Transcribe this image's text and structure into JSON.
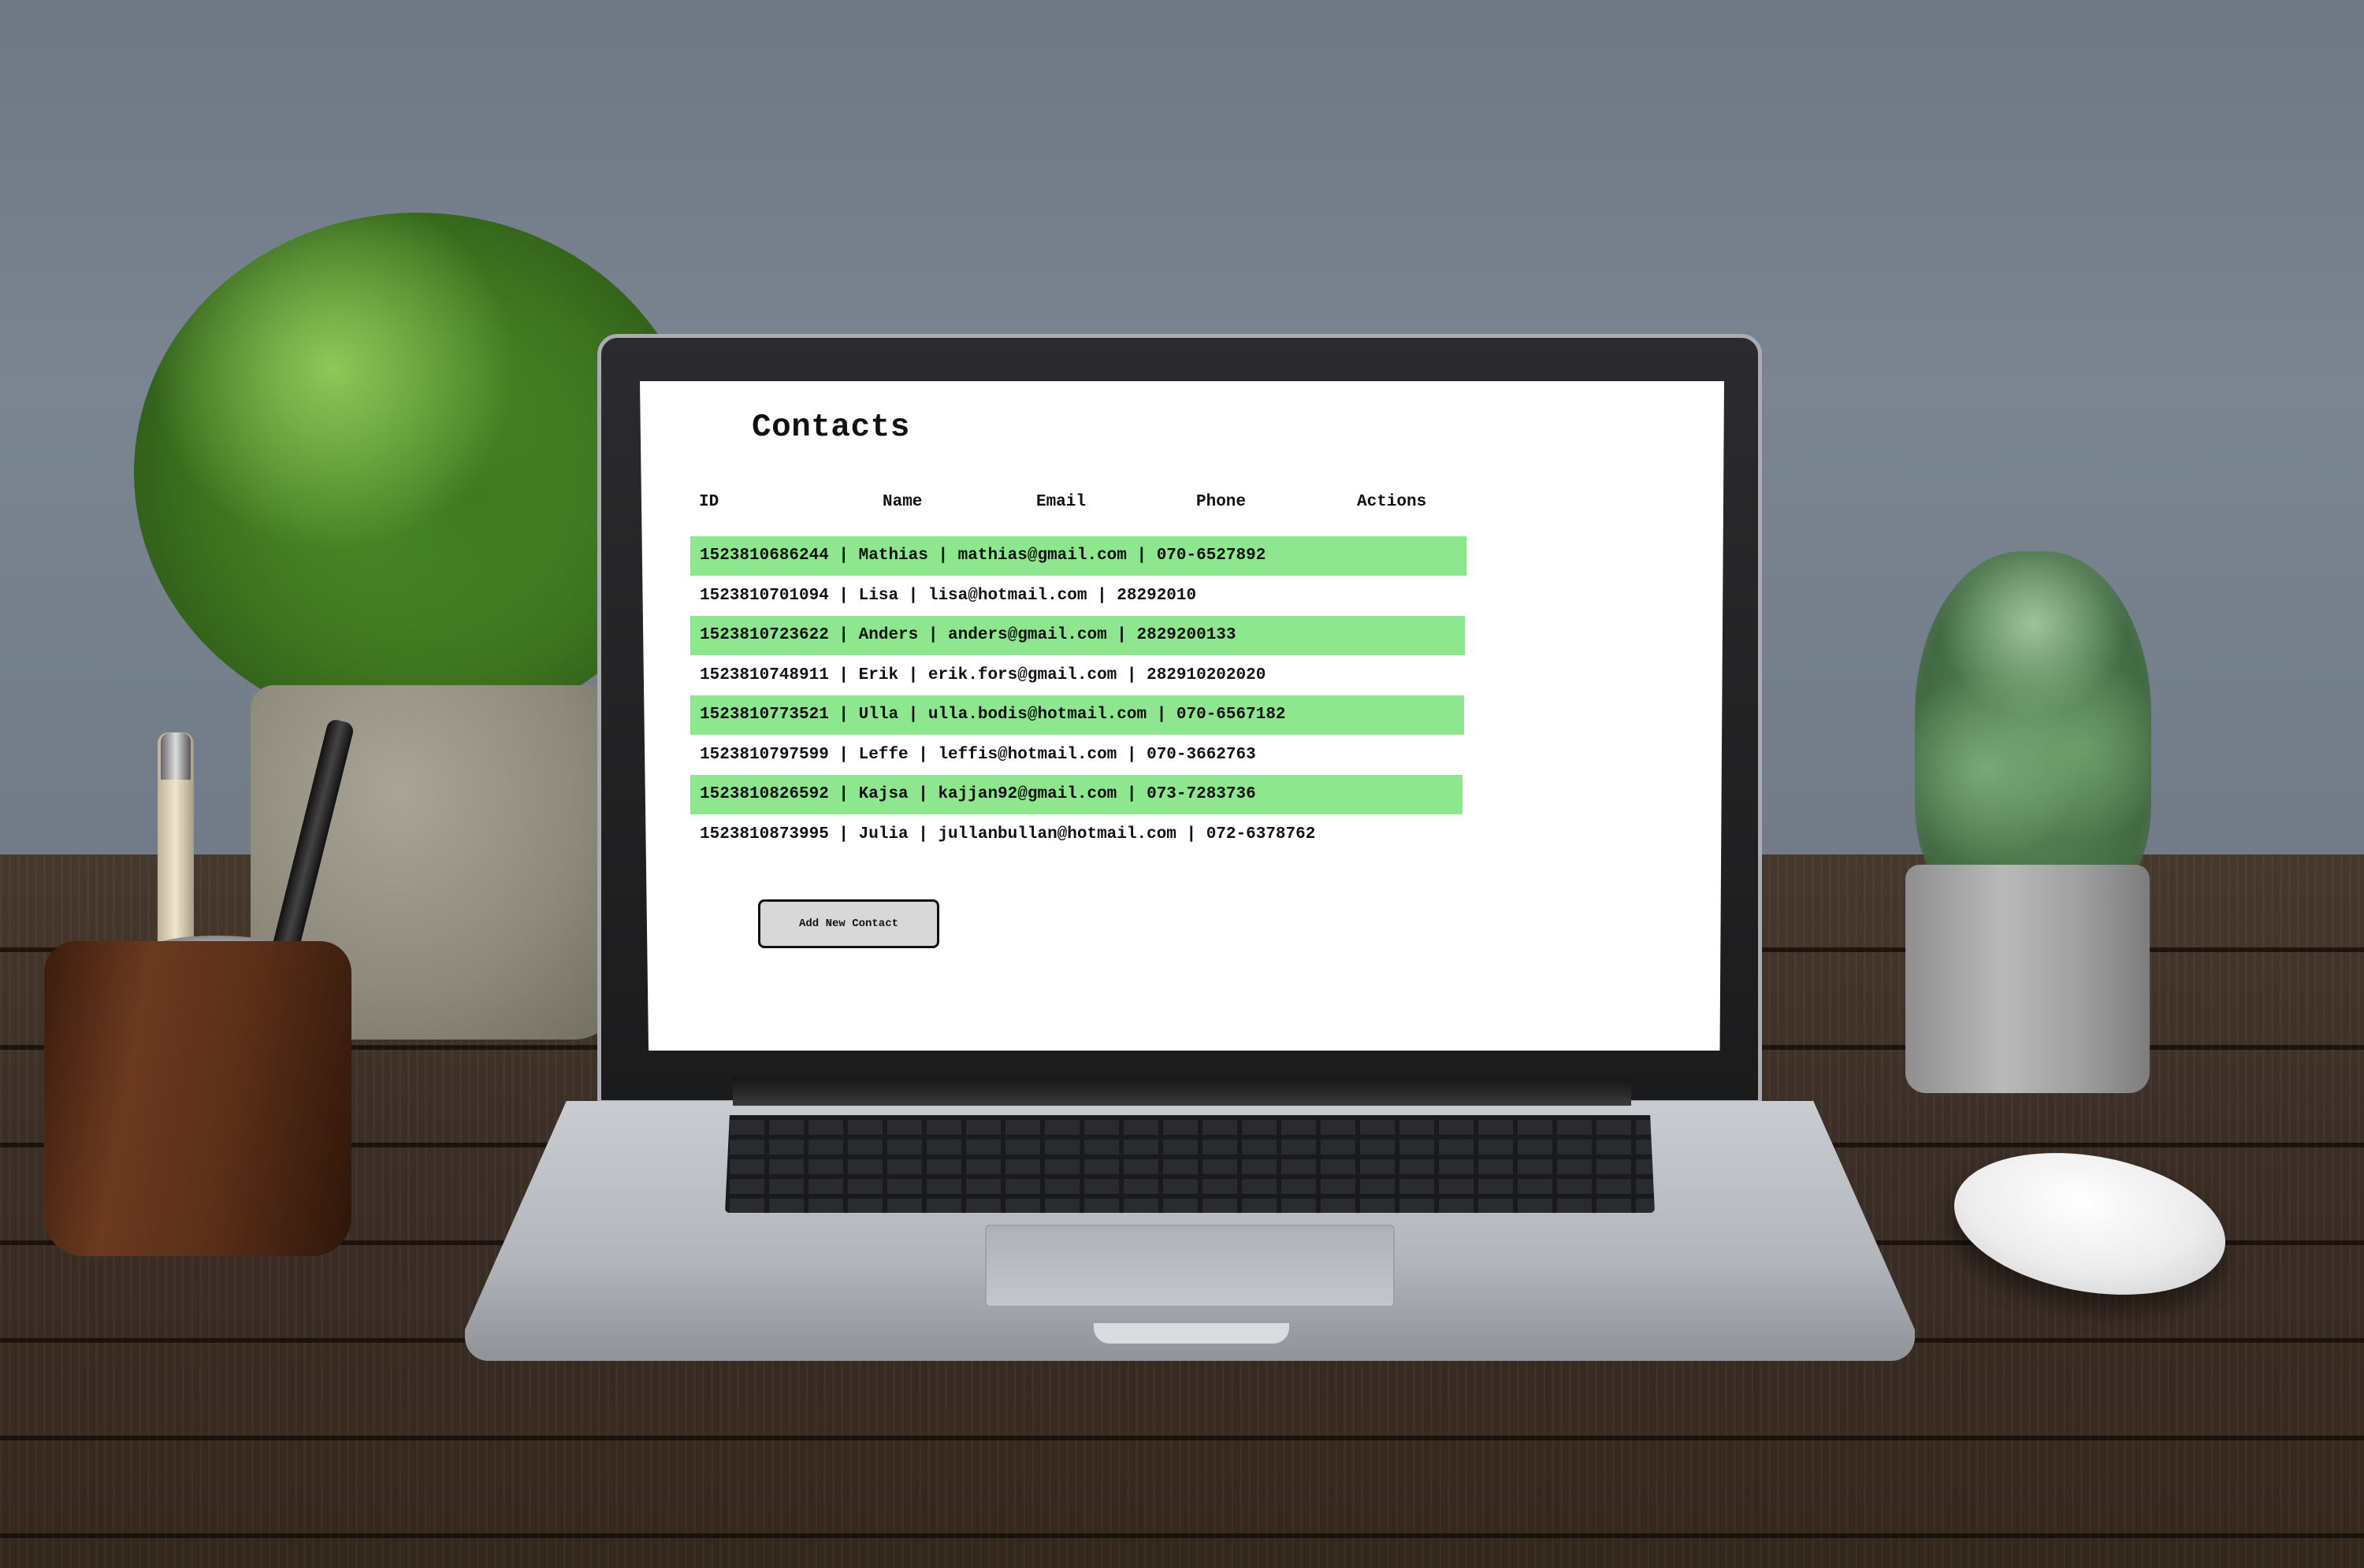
{
  "page": {
    "title": "Contacts"
  },
  "table": {
    "headers": [
      "ID",
      "Name",
      "Email",
      "Phone",
      "Actions"
    ],
    "rows": [
      {
        "id": "1523810686244",
        "name": "Mathias",
        "email": "mathias@gmail.com",
        "phone": "070-6527892",
        "text": "1523810686244 | Mathias | mathias@gmail.com | 070-6527892"
      },
      {
        "id": "1523810701094",
        "name": "Lisa",
        "email": "lisa@hotmail.com",
        "phone": "28292010",
        "text": "1523810701094 | Lisa | lisa@hotmail.com | 28292010"
      },
      {
        "id": "1523810723622",
        "name": "Anders",
        "email": "anders@gmail.com",
        "phone": "2829200133",
        "text": "1523810723622 | Anders | anders@gmail.com | 2829200133"
      },
      {
        "id": "1523810748911",
        "name": "Erik",
        "email": "erik.fors@gmail.com",
        "phone": "282910202020",
        "text": "1523810748911 | Erik | erik.fors@gmail.com | 282910202020"
      },
      {
        "id": "1523810773521",
        "name": "Ulla",
        "email": "ulla.bodis@hotmail.com",
        "phone": "070-6567182",
        "text": "1523810773521 | Ulla | ulla.bodis@hotmail.com | 070-6567182"
      },
      {
        "id": "1523810797599",
        "name": "Leffe",
        "email": "leffis@hotmail.com",
        "phone": "070-3662763",
        "text": "1523810797599 | Leffe | leffis@hotmail.com | 070-3662763"
      },
      {
        "id": "1523810826592",
        "name": "Kajsa",
        "email": "kajjan92@gmail.com",
        "phone": "073-7283736",
        "text": "1523810826592 | Kajsa | kajjan92@gmail.com | 073-7283736"
      },
      {
        "id": "1523810873995",
        "name": "Julia",
        "email": "jullanbullan@hotmail.com",
        "phone": "072-6378762",
        "text": "1523810873995 | Julia | jullanbullan@hotmail.com | 072-6378762"
      }
    ]
  },
  "actions": {
    "add_label": "Add New Contact"
  },
  "colors": {
    "row_stripe": "#8ee68e",
    "screen_background": "#ffffff",
    "button_background": "#d8d8d8"
  }
}
